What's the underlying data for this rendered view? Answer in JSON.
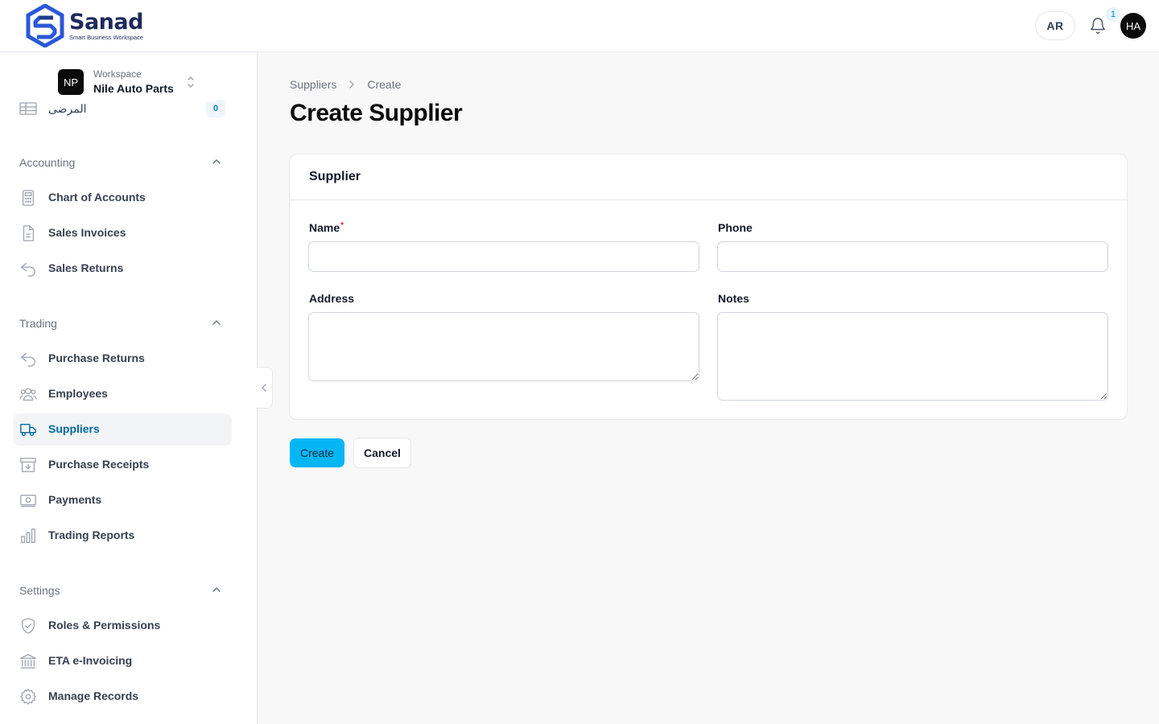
{
  "brand": {
    "name": "Sanad",
    "tagline": "Smart Business Workspace",
    "colors": {
      "primary": "#1e2a5a",
      "accent": "#06b6f4",
      "link": "#0369a1"
    }
  },
  "header": {
    "lang_label": "AR",
    "notifications_count": "1",
    "user_initials": "HA"
  },
  "workspace": {
    "kicker": "Workspace",
    "initials": "NP",
    "name": "Nile Auto Parts"
  },
  "sidebar": {
    "ghost_item": {
      "label": "المرضى",
      "badge": "0",
      "icon": "table-icon"
    },
    "sections": [
      {
        "title": "Accounting",
        "items": [
          {
            "label": "Chart of Accounts",
            "icon": "calculator-icon"
          },
          {
            "label": "Sales Invoices",
            "icon": "document-icon"
          },
          {
            "label": "Sales Returns",
            "icon": "return-arrow-icon"
          }
        ]
      },
      {
        "title": "Trading",
        "items": [
          {
            "label": "Purchase Returns",
            "icon": "return-arrow-icon"
          },
          {
            "label": "Employees",
            "icon": "users-icon"
          },
          {
            "label": "Suppliers",
            "icon": "truck-icon",
            "active": true
          },
          {
            "label": "Purchase Receipts",
            "icon": "archive-icon"
          },
          {
            "label": "Payments",
            "icon": "banknote-icon"
          },
          {
            "label": "Trading Reports",
            "icon": "bar-chart-icon"
          }
        ]
      },
      {
        "title": "Settings",
        "items": [
          {
            "label": "Roles & Permissions",
            "icon": "shield-check-icon"
          },
          {
            "label": "ETA e-Invoicing",
            "icon": "bank-icon"
          },
          {
            "label": "Manage Records",
            "icon": "gear-icon"
          }
        ]
      }
    ]
  },
  "breadcrumb": [
    "Suppliers",
    "Create"
  ],
  "page_title": "Create Supplier",
  "form": {
    "card_title": "Supplier",
    "fields": {
      "name": {
        "label": "Name",
        "required": true,
        "value": ""
      },
      "phone": {
        "label": "Phone",
        "value": ""
      },
      "address": {
        "label": "Address",
        "value": ""
      },
      "notes": {
        "label": "Notes",
        "value": ""
      }
    },
    "create_label": "Create",
    "cancel_label": "Cancel"
  }
}
